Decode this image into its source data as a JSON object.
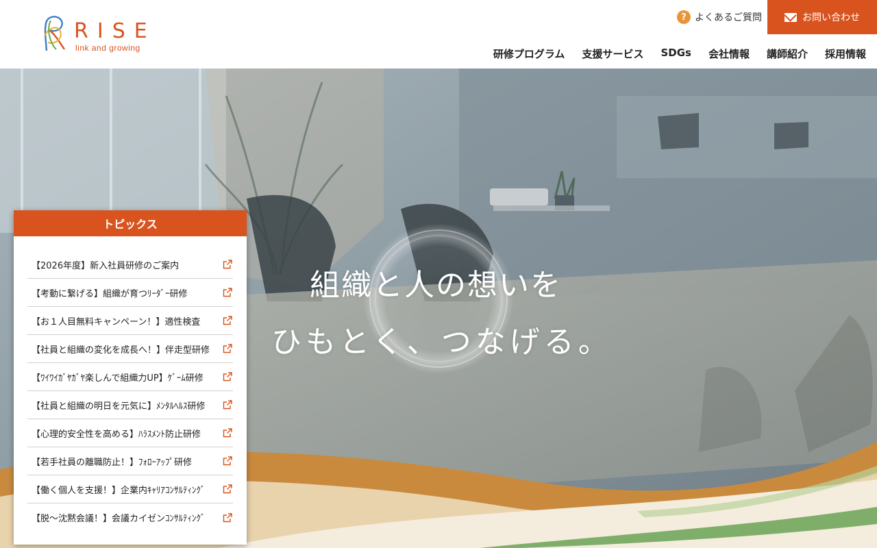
{
  "brand": {
    "name": "RISE",
    "tagline": "link and growing",
    "accent": "#d9531e"
  },
  "header": {
    "faq_label": "よくあるご質問",
    "faq_icon": "?",
    "contact_label": "お問い合わせ"
  },
  "nav": [
    "研修プログラム",
    "支援サービス",
    "SDGs",
    "会社情報",
    "講師紹介",
    "採用情報"
  ],
  "hero": {
    "catch_line1": "組織と人の想いを",
    "catch_line2": "ひもとく、つなげる。"
  },
  "topics": {
    "title": "トピックス",
    "items": [
      "【2026年度】新入社員研修のご案内",
      "【考動に繋げる】組織が育つﾘｰﾀﾞｰ研修",
      "【お１人目無料キャンペーン！】適性検査",
      "【社員と組織の変化を成長へ！】伴走型研修",
      "【ﾜｲﾜｲｶﾞﾔｶﾞﾔ楽しんで組織力UP】ｹﾞｰﾑ研修",
      "【社員と組織の明日を元気に】ﾒﾝﾀﾙﾍﾙｽ研修",
      "【心理的安全性を高める】ﾊﾗｽﾒﾝﾄ防止研修",
      "【若手社員の離職防止！】ﾌｫﾛｰｱｯﾌﾟ研修",
      "【働く個人を支援！】企業内ｷｬﾘｱｺﾝｻﾙﾃｨﾝｸﾞ",
      "【脱～沈黙会議！】会議カイゼンｺﾝｻﾙﾃｨﾝｸﾞ"
    ]
  },
  "colors": {
    "accent": "#d9531e",
    "faq_icon": "#e8953a",
    "wave_green": "#7fae6a",
    "wave_gold": "#c98a3e"
  }
}
